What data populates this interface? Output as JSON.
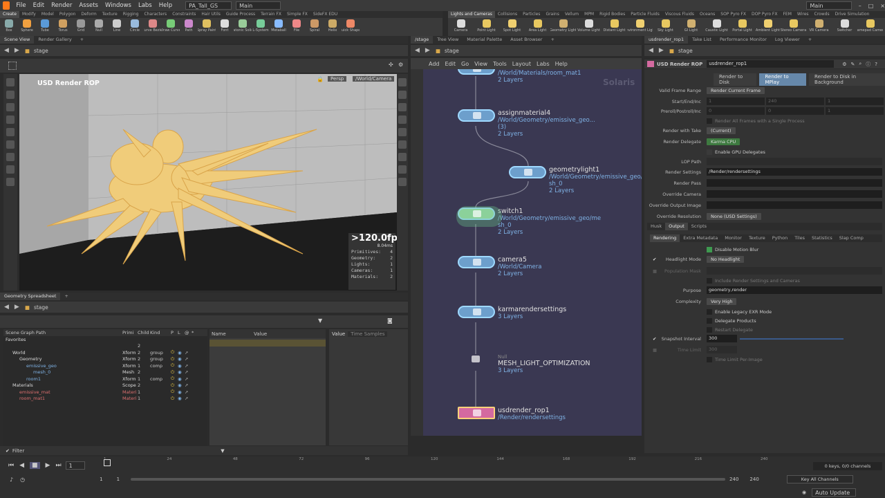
{
  "menubar": {
    "items": [
      "File",
      "Edit",
      "Render",
      "Assets",
      "Windows",
      "Labs",
      "Help"
    ],
    "desktop": "PA_Tall_GS",
    "context": "Main",
    "right_context": "Main"
  },
  "shelf_tabs_left": [
    "Create",
    "Modify",
    "Model",
    "Polygon",
    "Deform",
    "Texture",
    "Rigging",
    "Characters",
    "Constraints",
    "Hair Utils",
    "Guide Process",
    "Terrain FX",
    "Simple FX",
    "SideFX EDU"
  ],
  "shelf_tabs_right": [
    "Lights and Cameras",
    "Collisions",
    "Particles",
    "Grains",
    "Vellum",
    "MPM",
    "Rigid Bodies",
    "Particle Fluids",
    "Viscous Fluids",
    "Oceans",
    "SOP Pyro FX",
    "DOP Pyro FX",
    "FEM",
    "Wires",
    "Crowds",
    "Drive Simulation"
  ],
  "shelf_tools_left": [
    "Box",
    "Sphere",
    "Tube",
    "Torus",
    "Grid",
    "Null",
    "Line",
    "Circle",
    "Curve Bezier",
    "Draw Curve",
    "Path",
    "Spray Paint",
    "Font",
    "Platonic Solids",
    "L-System",
    "Metaball",
    "File",
    "Spiral",
    "Helix",
    "Quick Shapes"
  ],
  "shelf_tools_right": [
    "Camera",
    "Point Light",
    "Spot Light",
    "Area Light",
    "Geometry Light",
    "Volume Light",
    "Distant Light",
    "Environment Light",
    "Sky Light",
    "GI Light",
    "Caustic Light",
    "Portal Light",
    "Ambient Light",
    "Stereo Camera",
    "VR Camera",
    "Switcher",
    "Gamepad Camera"
  ],
  "left_pane": {
    "tabs": [
      "Scene View",
      "Render Gallery"
    ],
    "path": "stage",
    "viewport_title": "USD Render ROP",
    "persp": "Persp",
    "camera": "/World/Camera",
    "fps": ">120.0fps",
    "fps_ms": "8.04ms",
    "stats": [
      {
        "label": "Primitives:",
        "value": "4"
      },
      {
        "label": "Geometry:",
        "value": "2"
      },
      {
        "label": "Lights:",
        "value": "1"
      },
      {
        "label": "Cameras:",
        "value": "1"
      },
      {
        "label": "Materials:",
        "value": "2"
      }
    ]
  },
  "spreadsheet": {
    "tab": "Geometry Spreadsheet",
    "path": "stage",
    "columns": [
      "Scene Graph Path",
      "Primi",
      "Child",
      "Kind",
      "P",
      "L",
      "@",
      "*"
    ],
    "rows": [
      {
        "name": "Favorites",
        "type": "",
        "child": "",
        "kind": "",
        "indent": 0
      },
      {
        "name": "",
        "type": "",
        "child": "2",
        "kind": "",
        "indent": 0
      },
      {
        "name": "World",
        "type": "Xform",
        "child": "2",
        "kind": "group",
        "indent": 1
      },
      {
        "name": "Geometry",
        "type": "Xform",
        "child": "2",
        "kind": "group",
        "indent": 2
      },
      {
        "name": "emissive_geo",
        "type": "Xform",
        "child": "1",
        "kind": "comp",
        "indent": 3
      },
      {
        "name": "mesh_0",
        "type": "Mesh",
        "child": "2",
        "kind": "",
        "indent": 4
      },
      {
        "name": "room1",
        "type": "Xform",
        "child": "1",
        "kind": "comp",
        "indent": 3
      },
      {
        "name": "Materials",
        "type": "Scope",
        "child": "2",
        "kind": "",
        "indent": 1
      },
      {
        "name": "emissive_mat",
        "type": "Materi",
        "child": "1",
        "kind": "",
        "indent": 2
      },
      {
        "name": "room_mat1",
        "type": "Materi",
        "child": "1",
        "kind": "",
        "indent": 2
      }
    ],
    "attr_columns": [
      "Name",
      "Value"
    ],
    "value_tabs": [
      "Value",
      "Time Samples"
    ],
    "filter": "Filter"
  },
  "network": {
    "tabs": [
      "/stage",
      "Tree View",
      "Material Palette",
      "Asset Browser"
    ],
    "path": "stage",
    "menu": [
      "Add",
      "Edit",
      "Go",
      "View",
      "Tools",
      "Layout",
      "Labs",
      "Help"
    ],
    "watermark": "Solaris",
    "nodes": [
      {
        "name": "room_mat1",
        "path": "/World/Materials/room_mat1",
        "layers": "2 Layers"
      },
      {
        "name": "assignmaterial4",
        "path": "/World/Geometry/emissive_geo...",
        "extra": "(3)",
        "layers": "2 Layers"
      },
      {
        "name": "geometrylight1",
        "path": "/World/Geometry/emissive_geo/m",
        "path2": "sh_0",
        "layers": "2 Layers"
      },
      {
        "name": "switch1",
        "path": "/World/Geometry/emissive_geo/me",
        "path2": "sh_0",
        "layers": "2 Layers"
      },
      {
        "name": "camera5",
        "path": "/World/Camera",
        "layers": "2 Layers"
      },
      {
        "name": "karmarendersettings",
        "path": "",
        "layers": "3 Layers"
      },
      {
        "name": "MESH_LIGHT_OPTIMIZATION",
        "sub": "Null",
        "path": "",
        "layers": "3 Layers"
      },
      {
        "name": "usdrender_rop1",
        "path": "/Render/rendersettings",
        "layers": ""
      }
    ]
  },
  "params": {
    "tabs": [
      "usdrender_rop1",
      "Take List",
      "Performance Monitor",
      "Log Viewer"
    ],
    "path": "stage",
    "type": "USD Render ROP",
    "node_name": "usdrender_rop1",
    "buttons": [
      "Render to Disk",
      "Render to MPlay",
      "Render to Disk in Background"
    ],
    "rows": [
      {
        "label": "Valid Frame Range",
        "value": "Render Current Frame"
      },
      {
        "label": "Start/End/Inc",
        "value": "1"
      },
      {
        "label": "Preroll/Postroll/Inc",
        "value": "0"
      },
      {
        "label": "",
        "value": "Render All Frames with a Single Process"
      },
      {
        "label": "Render with Take",
        "value": "(Current)"
      },
      {
        "label": "Render Delegate",
        "value": "Karma CPU"
      },
      {
        "label": "",
        "value": "Enable GPU Delegates"
      },
      {
        "label": "LOP Path",
        "value": ""
      },
      {
        "label": "Render Settings",
        "value": "/Render/rendersettings"
      },
      {
        "label": "Render Pass",
        "value": ""
      },
      {
        "label": "Override Camera",
        "value": ""
      },
      {
        "label": "Override Output Image",
        "value": ""
      },
      {
        "label": "Override Resolution",
        "value": "None (USD Settings)"
      }
    ],
    "main_tabs": [
      "Husk",
      "Output",
      "Scripts"
    ],
    "sub_tabs": [
      "Rendering",
      "Extra Metadata",
      "Monitor",
      "Texture",
      "Python",
      "Tiles",
      "Statistics",
      "Slap Comp"
    ],
    "rendering": [
      {
        "label": "",
        "value": "Disable Motion Blur"
      },
      {
        "label": "Headlight Mode",
        "value": "No Headlight"
      },
      {
        "label": "Population Mask",
        "value": ""
      },
      {
        "label": "",
        "value": "Include Render Settings and Cameras"
      },
      {
        "label": "Purpose",
        "value": "geometry,render"
      },
      {
        "label": "Complexity",
        "value": "Very High"
      },
      {
        "label": "",
        "value": "Enable Legacy EXR Mode"
      },
      {
        "label": "",
        "value": "Delegate Products"
      },
      {
        "label": "",
        "value": "Restart Delegate"
      },
      {
        "label": "Snapshot Interval",
        "value": "300"
      },
      {
        "label": "Time Limit",
        "value": "300"
      },
      {
        "label": "",
        "value": "Time Limit Per-Image"
      }
    ],
    "start_end": [
      "1",
      "240",
      "1"
    ],
    "preroll": [
      "0",
      "0",
      "1"
    ]
  },
  "timeline": {
    "current_frame": "1",
    "ticks": [
      "1",
      "24",
      "48",
      "72",
      "96",
      "120",
      "144",
      "168",
      "192",
      "216",
      "240"
    ],
    "start": "1",
    "start2": "1",
    "end": "240",
    "end2": "240",
    "keys": "0 keys, 0/0 channels",
    "key_all": "Key All Channels",
    "auto_update": "Auto Update"
  },
  "colors": {
    "network_bg": "#3a3852",
    "node_blue": "#6d9fcc",
    "node_green": "#9bd6a2",
    "node_pink": "#d46aa0",
    "accent_blue": "#7fb2e5",
    "model_color": "#f0cc7a"
  }
}
